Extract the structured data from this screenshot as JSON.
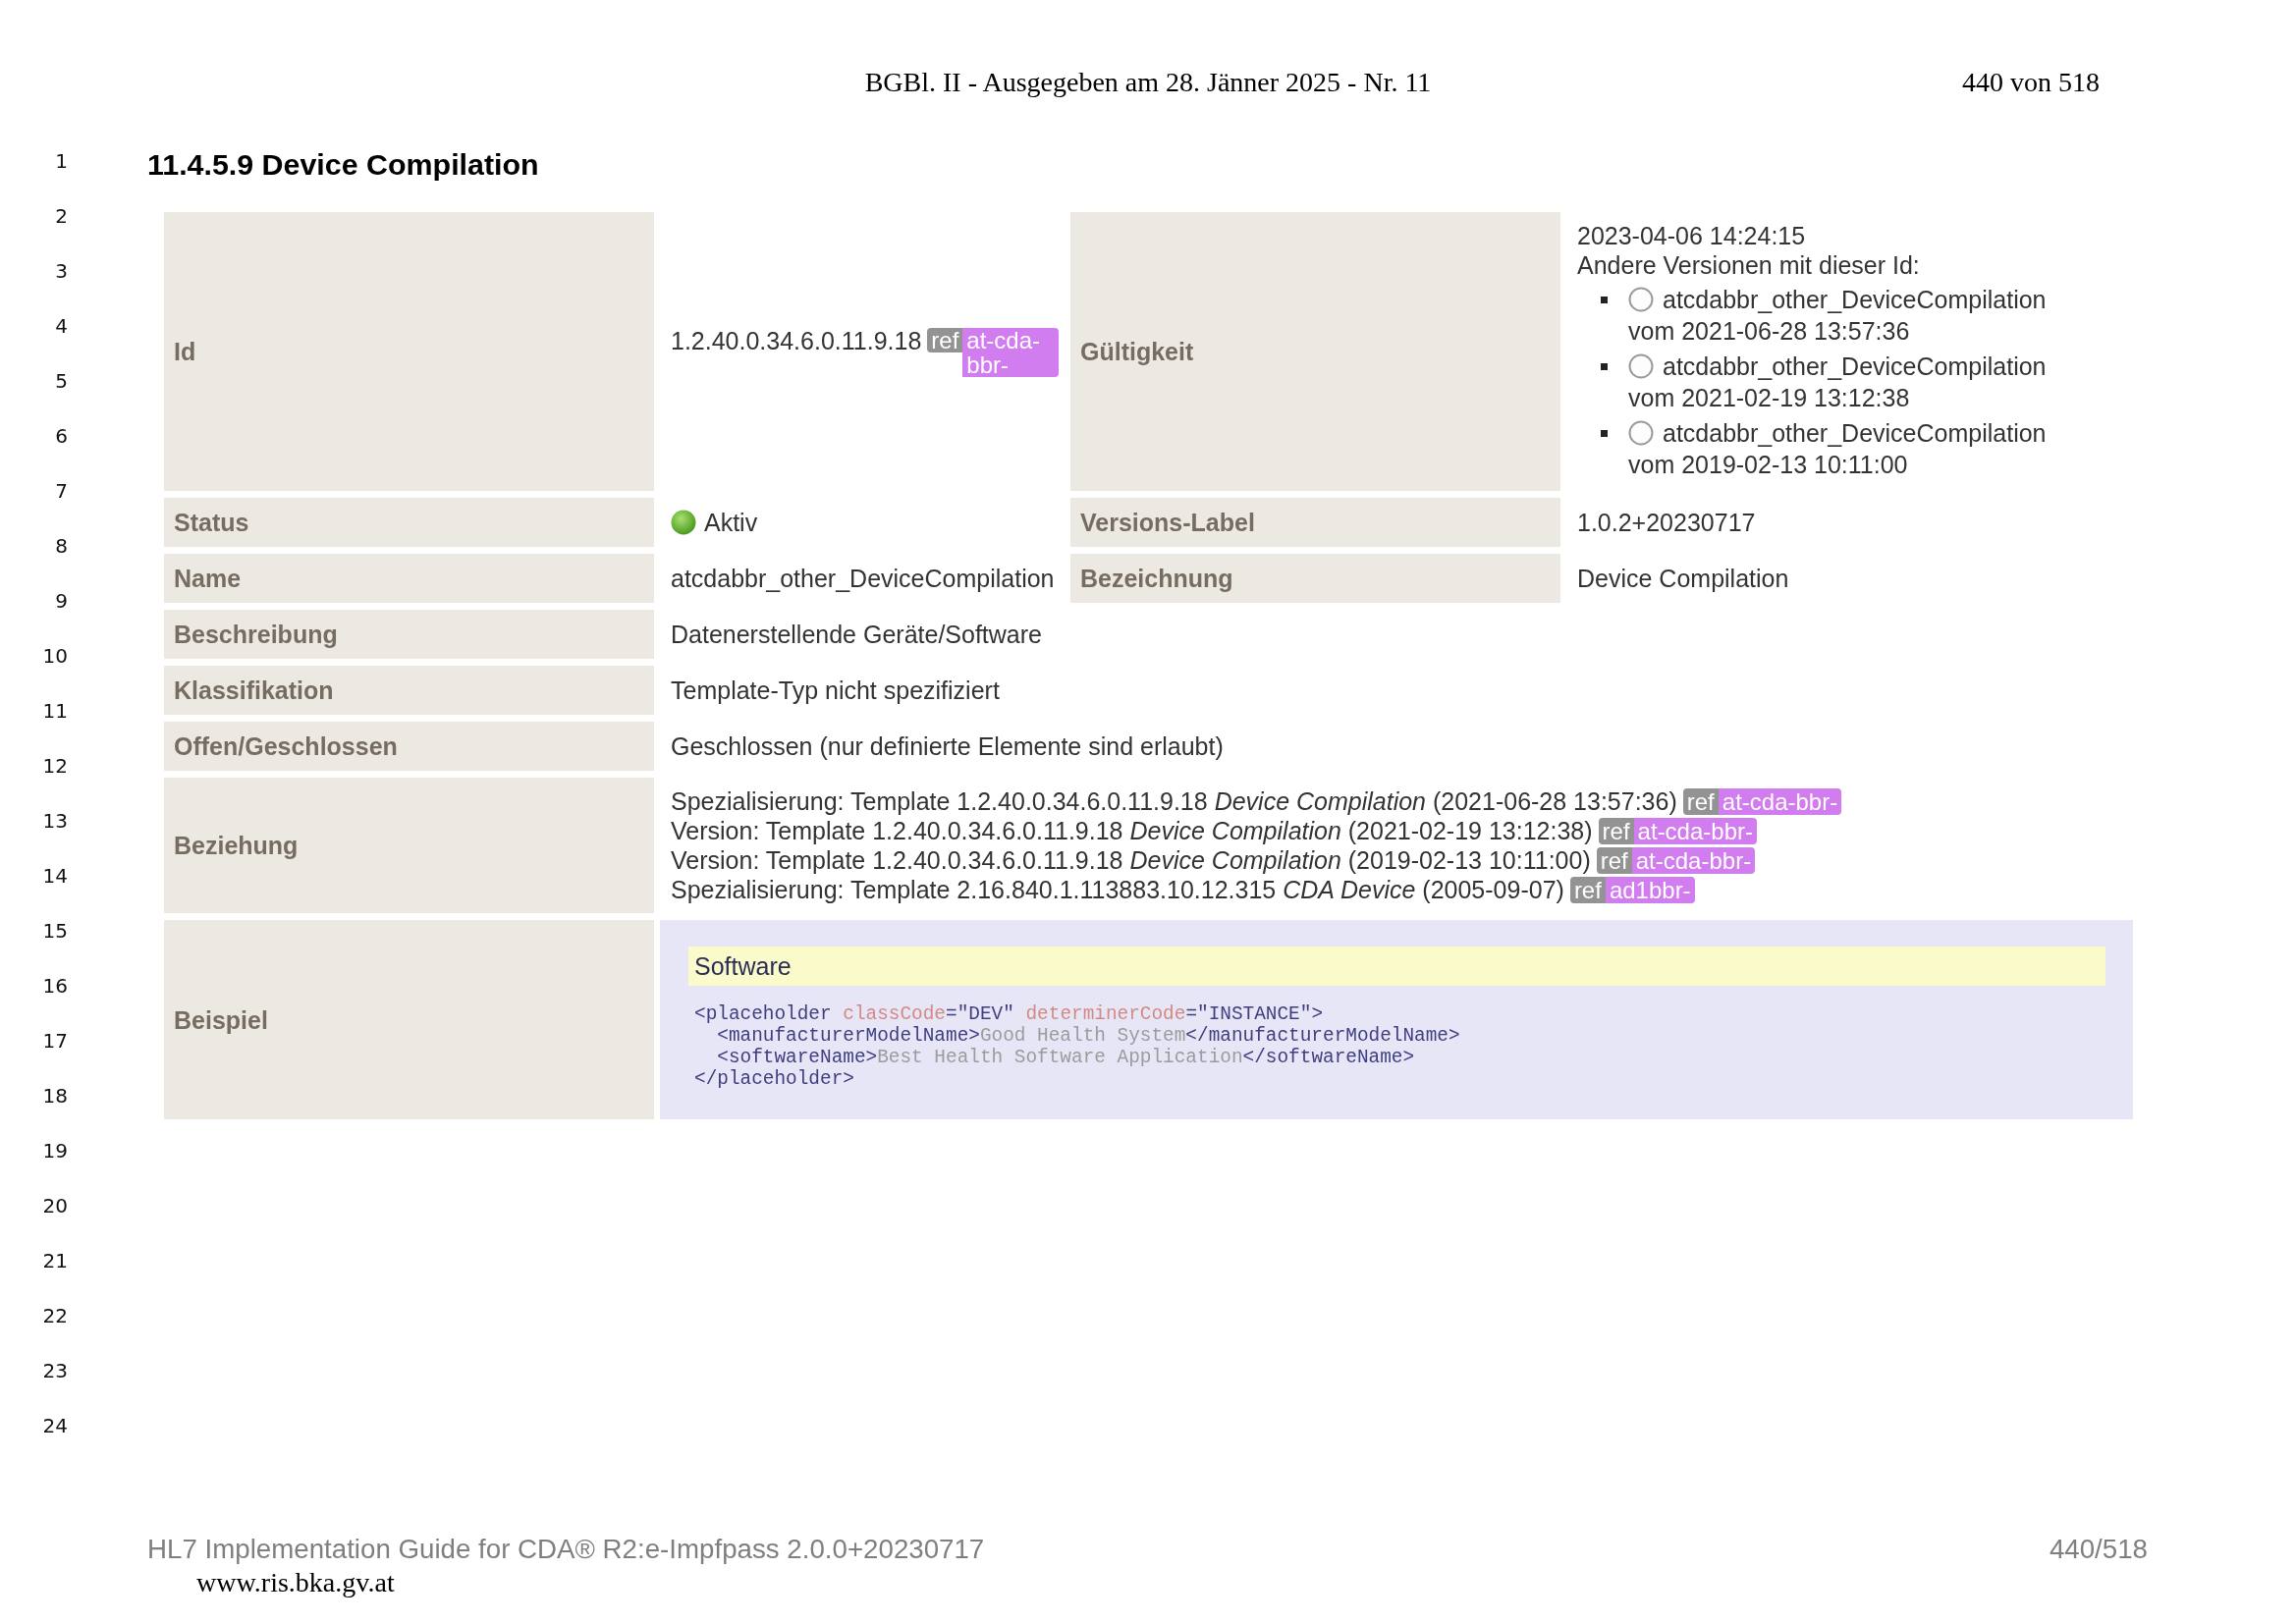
{
  "page_header": {
    "title": "BGBl. II - Ausgegeben am 28. Jänner 2025 - Nr. 11",
    "page": "440 von 518"
  },
  "line_numbers": [
    "1",
    "2",
    "3",
    "4",
    "5",
    "6",
    "7",
    "8",
    "9",
    "10",
    "11",
    "12",
    "13",
    "14",
    "15",
    "16",
    "17",
    "18",
    "19",
    "20",
    "21",
    "22",
    "23",
    "24"
  ],
  "heading": "11.4.5.9 Device Compilation",
  "table": {
    "rows": [
      {
        "kind": "id",
        "label": "Id",
        "value": "1.2.40.0.34.6.0.11.9.18",
        "ref": {
          "tag": "ref",
          "prefix": "at-cda-bbr-"
        },
        "label_2": "Gültigkeit",
        "effective": "2023-04-06 14:24:15",
        "versions_heading": "Andere Versionen mit dieser Id:",
        "versions": [
          {
            "name": "atcdabbr_other_DeviceCompilation",
            "date": "vom 2021-06-28 13:57:36"
          },
          {
            "name": "atcdabbr_other_DeviceCompilation",
            "date": "vom 2021-02-19 13:12:38"
          },
          {
            "name": "atcdabbr_other_DeviceCompilation",
            "date": "vom 2019-02-13 10:11:00"
          }
        ]
      },
      {
        "kind": "status",
        "label": "Status",
        "value": "Aktiv",
        "label_2": "Versions-Label",
        "value_2": "1.0.2+20230717"
      },
      {
        "kind": "pair",
        "label": "Name",
        "value": "atcdabbr_other_DeviceCompilation",
        "label_2": "Bezeichnung",
        "value_2": "Device Compilation"
      },
      {
        "kind": "single",
        "label": "Beschreibung",
        "value": "Datenerstellende Geräte/Software"
      },
      {
        "kind": "single",
        "label": "Klassifikation",
        "value": "Template-Typ nicht spezifiziert"
      },
      {
        "kind": "single",
        "label": "Offen/Geschlossen",
        "value": "Geschlossen (nur definierte Elemente sind erlaubt)"
      },
      {
        "kind": "relations",
        "label": "Beziehung",
        "items": [
          {
            "text": "Spezialisierung: Template 1.2.40.0.34.6.0.11.9.18 *Device Compilation* (2021-06-28 13:57:36)",
            "ref": {
              "tag": "ref",
              "prefix": "at-cda-bbr-"
            }
          },
          {
            "text": "Version: Template 1.2.40.0.34.6.0.11.9.18 *Device Compilation* (2021-02-19 13:12:38)",
            "ref": {
              "tag": "ref",
              "prefix": "at-cda-bbr-"
            }
          },
          {
            "text": "Version: Template 1.2.40.0.34.6.0.11.9.18 *Device Compilation* (2019-02-13 10:11:00)",
            "ref": {
              "tag": "ref",
              "prefix": "at-cda-bbr-"
            }
          },
          {
            "text": "Spezialisierung: Template 2.16.840.1.113883.10.12.315 *CDA Device* (2005-09-07)",
            "ref": {
              "tag": "ref",
              "prefix": "ad1bbr-"
            }
          }
        ]
      },
      {
        "kind": "example",
        "label": "Beispiel",
        "title": "Software",
        "code": [
          {
            "tokens": [
              {
                "kind": "tag",
                "text": "<placeholder"
              },
              {
                "kind": "attr",
                "text": " classCode"
              },
              {
                "kind": "value",
                "text": "=\"DEV\""
              },
              {
                "kind": "attr",
                "text": " determinerCode"
              },
              {
                "kind": "value",
                "text": "=\"INSTANCE\">"
              }
            ],
            "children": [
              {
                "tokens": [
                  {
                    "kind": "tag",
                    "text": "<manufacturerModelName>"
                  },
                  {
                    "kind": "text",
                    "text": "Good Health System"
                  },
                  {
                    "kind": "tag",
                    "text": "</manufacturerModelName>"
                  }
                ]
              },
              {
                "tokens": [
                  {
                    "kind": "tag",
                    "text": "<softwareName>"
                  },
                  {
                    "kind": "text",
                    "text": "Best Health Software Application"
                  },
                  {
                    "kind": "tag",
                    "text": "</softwareName>"
                  }
                ]
              }
            ]
          },
          {
            "tokens": [
              {
                "kind": "tag",
                "text": "</placeholder>"
              }
            ]
          }
        ]
      }
    ]
  },
  "footer": {
    "guide": "HL7 Implementation Guide for CDA® R2:e-Impfpass 2.0.0+20230717",
    "page": "440/518",
    "site": "www.ris.bka.gv.at"
  }
}
